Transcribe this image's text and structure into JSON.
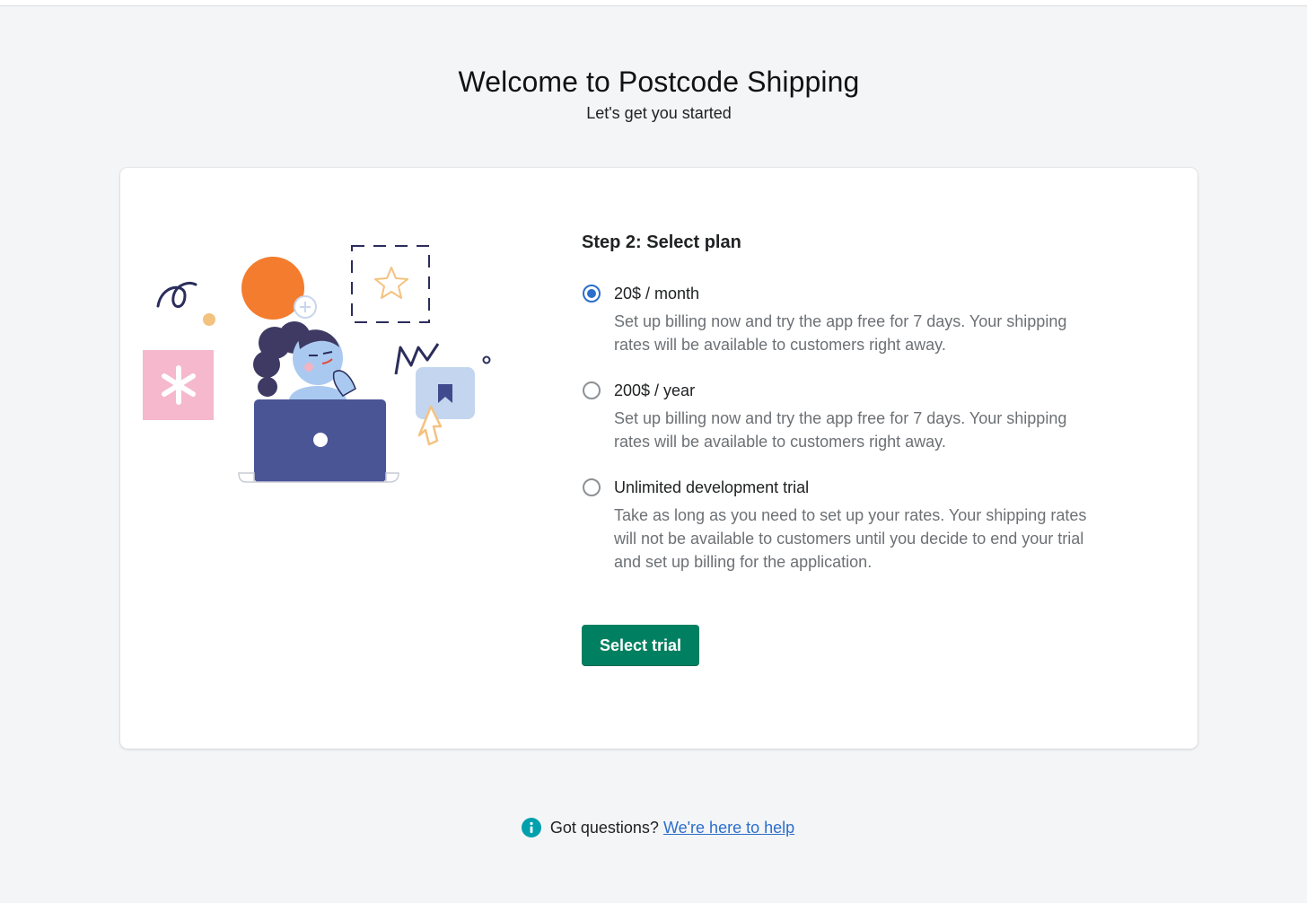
{
  "page": {
    "title": "Welcome to Postcode Shipping",
    "subtitle": "Let's get you started"
  },
  "card": {
    "illustration": "person-with-laptop-illustration",
    "step_title": "Step 2: Select plan",
    "plans": [
      {
        "label": "20$ / month",
        "help": "Set up billing now and try the app free for 7 days. Your shipping rates will be available to customers right away.",
        "selected": true
      },
      {
        "label": "200$ / year",
        "help": "Set up billing now and try the app free for 7 days. Your shipping rates will be available to customers right away.",
        "selected": false
      },
      {
        "label": "Unlimited development trial",
        "help": "Take as long as you need to set up your rates. Your shipping rates will not be available to customers until you decide to end your trial and set up billing for the application.",
        "selected": false
      }
    ],
    "button_label": "Select trial"
  },
  "footer": {
    "icon": "info-icon",
    "question": "Got questions?",
    "link_text": "We're here to help"
  },
  "colors": {
    "background": "#f4f5f7",
    "primary_button": "#008060",
    "radio_selected": "#2c6ecb",
    "link": "#2c6ecb",
    "info_icon": "#00a0ac"
  }
}
